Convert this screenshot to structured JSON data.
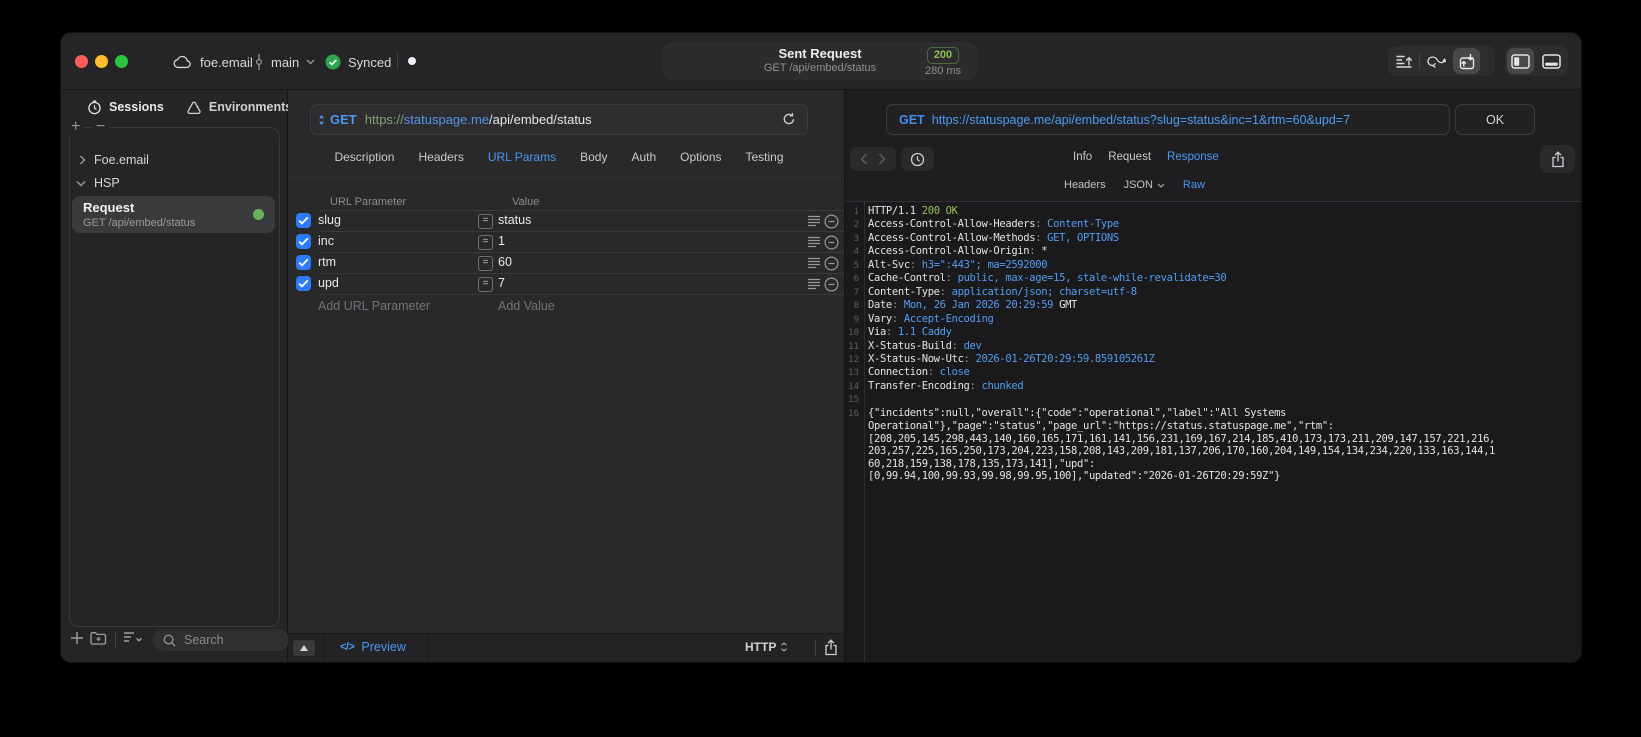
{
  "titlebar": {
    "project": "foe.email",
    "branch": "main",
    "sync_status": "Synced",
    "center": {
      "title": "Sent Request",
      "subtitle": "GET /api/embed/status",
      "status_code": "200",
      "duration": "280 ms"
    }
  },
  "sidebar": {
    "tabs": {
      "sessions": "Sessions",
      "environments": "Environments"
    },
    "tree_items": [
      {
        "label": "Foe.email"
      },
      {
        "label": "HSP"
      }
    ],
    "request_item": {
      "title": "Request",
      "subtitle": "GET /api/embed/status"
    },
    "search_placeholder": "Search"
  },
  "request": {
    "method": "GET",
    "url_scheme": "https://",
    "url_host": "statuspage.me",
    "url_path": "/api/embed/status",
    "tabs": [
      "Description",
      "Headers",
      "URL Params",
      "Body",
      "Auth",
      "Options",
      "Testing"
    ],
    "active_tab": "URL Params",
    "params": {
      "col_name": "URL Parameter",
      "col_value": "Value",
      "rows": [
        {
          "name": "slug",
          "value": "status",
          "checked": true
        },
        {
          "name": "inc",
          "value": "1",
          "checked": true
        },
        {
          "name": "rtm",
          "value": "60",
          "checked": true
        },
        {
          "name": "upd",
          "value": "7",
          "checked": true
        }
      ],
      "add_name_placeholder": "Add URL Parameter",
      "add_value_placeholder": "Add Value"
    },
    "footer": {
      "preview_label": "Preview",
      "code_glyph": "</>",
      "protocol": "HTTP"
    }
  },
  "response": {
    "method": "GET",
    "url": "https://statuspage.me/api/embed/status?slug=status&inc=1&rtm=60&upd=7",
    "status_code": "200",
    "status_text": "OK",
    "tabs": [
      "Info",
      "Request",
      "Response"
    ],
    "active_tab": "Response",
    "subtabs": [
      {
        "label": "Headers"
      },
      {
        "label": "JSON",
        "chevron": true
      },
      {
        "label": "Raw"
      }
    ],
    "active_subtab": "Raw",
    "lines": [
      {
        "n": "1",
        "parts": [
          {
            "t": "HTTP/1.1 ",
            "c": "w"
          },
          {
            "t": "200 OK",
            "c": "g"
          }
        ]
      },
      {
        "n": "2",
        "parts": [
          {
            "t": "Access-Control-Allow-Headers",
            "c": "w"
          },
          {
            "t": ": ",
            "c": "d"
          },
          {
            "t": "Content-Type",
            "c": "b"
          }
        ]
      },
      {
        "n": "3",
        "parts": [
          {
            "t": "Access-Control-Allow-Methods",
            "c": "w"
          },
          {
            "t": ": ",
            "c": "d"
          },
          {
            "t": "GET, OPTIONS",
            "c": "b"
          }
        ]
      },
      {
        "n": "4",
        "parts": [
          {
            "t": "Access-Control-Allow-Origin",
            "c": "w"
          },
          {
            "t": ": ",
            "c": "d"
          },
          {
            "t": "*",
            "c": "w"
          }
        ]
      },
      {
        "n": "5",
        "parts": [
          {
            "t": "Alt-Svc",
            "c": "w"
          },
          {
            "t": ": ",
            "c": "d"
          },
          {
            "t": "h3=\":443\"; ma=2592000",
            "c": "b"
          }
        ]
      },
      {
        "n": "6",
        "parts": [
          {
            "t": "Cache-Control",
            "c": "w"
          },
          {
            "t": ": ",
            "c": "d"
          },
          {
            "t": "public, max-age=15, stale-while-revalidate=30",
            "c": "b"
          }
        ]
      },
      {
        "n": "7",
        "parts": [
          {
            "t": "Content-Type",
            "c": "w"
          },
          {
            "t": ": ",
            "c": "d"
          },
          {
            "t": "application/json; charset=utf-8",
            "c": "b"
          }
        ]
      },
      {
        "n": "8",
        "parts": [
          {
            "t": "Date",
            "c": "w"
          },
          {
            "t": ": ",
            "c": "d"
          },
          {
            "t": "Mon, 26 Jan 2026 20:29:59",
            "c": "b"
          },
          {
            "t": " GMT",
            "c": "w"
          }
        ]
      },
      {
        "n": "9",
        "parts": [
          {
            "t": "Vary",
            "c": "w"
          },
          {
            "t": ": ",
            "c": "d"
          },
          {
            "t": "Accept-Encoding",
            "c": "b"
          }
        ]
      },
      {
        "n": "10",
        "parts": [
          {
            "t": "Via",
            "c": "w"
          },
          {
            "t": ": ",
            "c": "d"
          },
          {
            "t": "1.1 Caddy",
            "c": "b"
          }
        ]
      },
      {
        "n": "11",
        "parts": [
          {
            "t": "X-Status-Build",
            "c": "w"
          },
          {
            "t": ": ",
            "c": "d"
          },
          {
            "t": "dev",
            "c": "b"
          }
        ]
      },
      {
        "n": "12",
        "parts": [
          {
            "t": "X-Status-Now-Utc",
            "c": "w"
          },
          {
            "t": ": ",
            "c": "d"
          },
          {
            "t": "2026-01-26T20:29:59.859105261Z",
            "c": "b"
          }
        ]
      },
      {
        "n": "13",
        "parts": [
          {
            "t": "Connection",
            "c": "w"
          },
          {
            "t": ": ",
            "c": "d"
          },
          {
            "t": "close",
            "c": "b"
          }
        ]
      },
      {
        "n": "14",
        "parts": [
          {
            "t": "Transfer-Encoding",
            "c": "w"
          },
          {
            "t": ": ",
            "c": "d"
          },
          {
            "t": "chunked",
            "c": "b"
          }
        ]
      },
      {
        "n": "15",
        "parts": []
      },
      {
        "n": "16",
        "parts": [
          {
            "t": "{\"incidents\":null,\"overall\":{\"code\":\"operational\",\"label\":\"All Systems",
            "c": "w"
          }
        ]
      },
      {
        "n": "",
        "parts": [
          {
            "t": "Operational\"},\"page\":\"status\",\"page_url\":\"https://status.statuspage.me\",\"rtm\":",
            "c": "w"
          }
        ]
      },
      {
        "n": "",
        "parts": [
          {
            "t": "[208,205,145,298,443,140,160,165,171,161,141,156,231,169,167,214,185,410,173,173,211,209,147,157,221,216,",
            "c": "w"
          }
        ]
      },
      {
        "n": "",
        "parts": [
          {
            "t": "203,257,225,165,250,173,204,223,158,208,143,209,181,137,206,170,160,204,149,154,134,234,220,133,163,144,1",
            "c": "w"
          }
        ]
      },
      {
        "n": "",
        "parts": [
          {
            "t": "60,218,159,138,178,135,173,141],\"upd\":",
            "c": "w"
          }
        ]
      },
      {
        "n": "",
        "parts": [
          {
            "t": "[0,99.94,100,99.93,99.98,99.95,100],\"updated\":\"2026-01-26T20:29:59Z\"}",
            "c": "w"
          }
        ]
      }
    ]
  },
  "colors": {
    "accent_blue": "#4a98f0",
    "status_green": "#8dc051",
    "checkbox_blue": "#2e7bf6",
    "sync_green": "#2fa44e"
  }
}
